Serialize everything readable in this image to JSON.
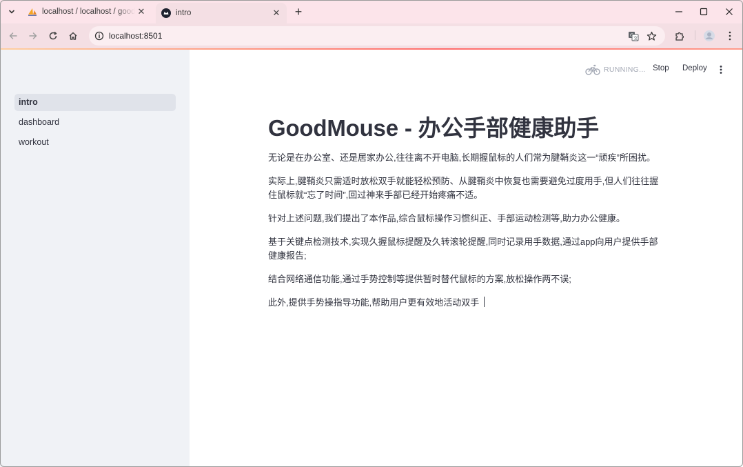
{
  "browser": {
    "tabs": [
      {
        "title": "localhost / localhost / goodmouse",
        "active": false,
        "favicon": "phpmyadmin-sail-icon"
      },
      {
        "title": "intro",
        "active": true,
        "favicon": "streamlit-crown-icon"
      }
    ],
    "address_bar": {
      "url": "localhost:8501"
    },
    "accent_color": "#fce4ea"
  },
  "app": {
    "header": {
      "status": "RUNNING...",
      "stop_label": "Stop",
      "deploy_label": "Deploy"
    },
    "sidebar": {
      "items": [
        {
          "label": "intro",
          "selected": true
        },
        {
          "label": "dashboard",
          "selected": false
        },
        {
          "label": "workout",
          "selected": false
        }
      ]
    },
    "main": {
      "title": "GoodMouse - 办公手部健康助手",
      "paragraphs": [
        "无论是在办公室、还是居家办公,往往离不开电脑,长期握鼠标的人们常为腱鞘炎这一“顽疾”所困扰。",
        "实际上,腱鞘炎只需适时放松双手就能轻松预防、从腱鞘炎中恢复也需要避免过度用手,但人们往往握住鼠标就“忘了时间”,回过神来手部已经开始疼痛不适。",
        "针对上述问题,我们提出了本作品,综合鼠标操作习惯纠正、手部运动检测等,助力办公健康。",
        "基于关键点检测技术,实现久握鼠标提醒及久转滚轮提醒,同时记录用手数据,通过app向用户提供手部健康报告;",
        "结合网络通信功能,通过手势控制等提供暂时替代鼠标的方案,放松操作两不误;",
        "此外,提供手势操指导功能,帮助用户更有效地活动双手"
      ]
    }
  }
}
